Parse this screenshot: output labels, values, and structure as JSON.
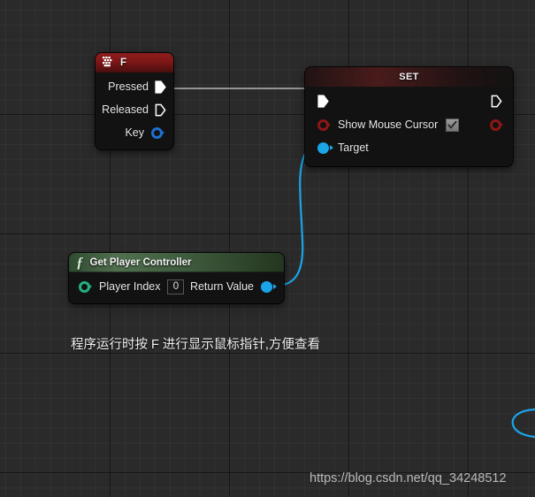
{
  "canvas": {
    "background_color": "#2a2a2a",
    "grid_minor_color": "#333333",
    "grid_major_color": "#1c1c1c"
  },
  "nodes": [
    {
      "id": "input-event-f",
      "title": "F",
      "header_icon": "keyboard-icon",
      "header_color": "#7e1717",
      "type": "event",
      "outputs": [
        {
          "label": "Pressed",
          "pin": "exec",
          "filled": true,
          "color": "#ffffff"
        },
        {
          "label": "Released",
          "pin": "exec",
          "filled": false,
          "color": "#ffffff"
        },
        {
          "label": "Key",
          "pin": "circle",
          "filled": false,
          "color": "#1f6fd0"
        }
      ]
    },
    {
      "id": "set-show-mouse-cursor",
      "title": "SET",
      "header_color": "#8c2626",
      "type": "set",
      "exec_in": {
        "pin": "exec",
        "filled": true,
        "color": "#ffffff"
      },
      "exec_out": {
        "pin": "exec",
        "filled": false,
        "color": "#ffffff"
      },
      "inputs": [
        {
          "label": "Show Mouse Cursor",
          "pin": "circle",
          "filled": false,
          "color": "#8e1616",
          "widget": "checkbox",
          "checked": true
        },
        {
          "label": "Target",
          "pin": "circle",
          "filled": true,
          "color": "#1aa5e8"
        }
      ],
      "outputs": [
        {
          "label": "",
          "pin": "circle",
          "filled": false,
          "color": "#8e1616"
        }
      ]
    },
    {
      "id": "get-player-controller",
      "title": "Get Player Controller",
      "header_icon": "function-icon",
      "header_color": "#51704f",
      "type": "function",
      "inputs": [
        {
          "label": "Player Index",
          "pin": "circle",
          "filled": false,
          "color": "#23b083",
          "widget": "valuebox",
          "value": "0"
        }
      ],
      "outputs": [
        {
          "label": "Return Value",
          "pin": "circle",
          "filled": true,
          "color": "#1aa5e8"
        }
      ]
    }
  ],
  "wires": [
    {
      "from": "input-event-f.Pressed",
      "to": "set-show-mouse-cursor.exec_in",
      "color": "#b8b8b8",
      "kind": "exec"
    },
    {
      "from": "get-player-controller.Return Value",
      "to": "set-show-mouse-cursor.Target",
      "color": "#1aa5e8",
      "kind": "data"
    },
    {
      "from": "offscreen",
      "to": "offscreen",
      "color": "#1aa5e8",
      "kind": "data"
    }
  ],
  "annotation": {
    "text": "程序运行时按 F 进行显示鼠标指针,方便查看"
  },
  "watermark": {
    "text": "https://blog.csdn.net/qq_34248512"
  }
}
